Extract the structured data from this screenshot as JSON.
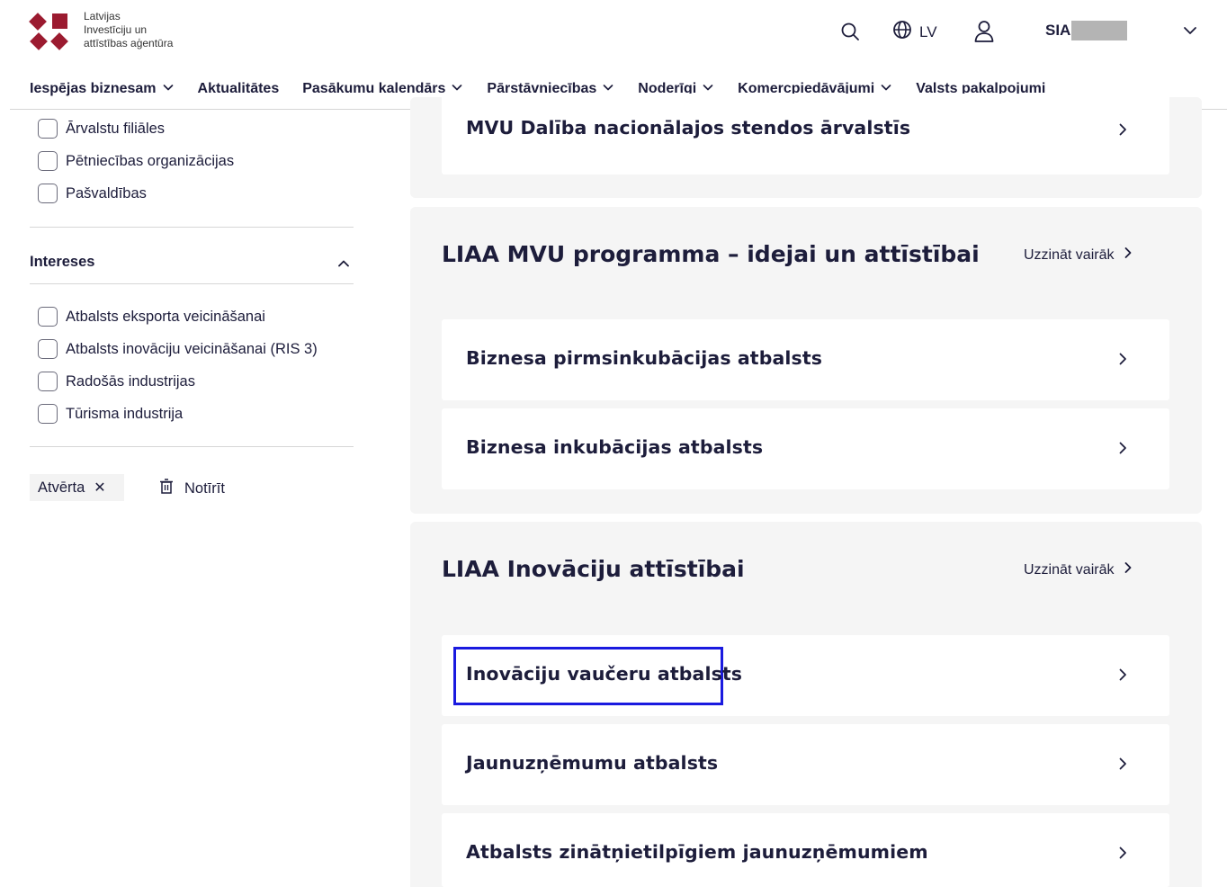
{
  "header": {
    "logo_lines": [
      "Latvijas",
      "Investīciju un",
      "attīstības aģentūra"
    ],
    "lang": "LV",
    "company_prefix": "SIA"
  },
  "nav": {
    "items": [
      {
        "label": "Iespējas biznesam",
        "dropdown": true
      },
      {
        "label": "Aktualitātes",
        "dropdown": false
      },
      {
        "label": "Pasākumu kalendārs",
        "dropdown": true
      },
      {
        "label": "Pārstāvniecības",
        "dropdown": true
      },
      {
        "label": "Noderīgi",
        "dropdown": true
      },
      {
        "label": "Komercpiedāvājumi",
        "dropdown": true
      },
      {
        "label": "Valsts pakalpojumi",
        "dropdown": false
      }
    ]
  },
  "sidebar": {
    "org_options": [
      "Ārvalstu filiāles",
      "Pētniecības organizācijas",
      "Pašvaldības"
    ],
    "interests_title": "Intereses",
    "interest_options": [
      "Atbalsts eksporta veicināšanai",
      "Atbalsts inovāciju veicināšanai (RIS 3)",
      "Radošās industrijas",
      "Tūrisma industrija"
    ],
    "chip_label": "Atvērta",
    "clear_label": "Notīrīt"
  },
  "main": {
    "top_card": "MVU Dalība nacionālajos stendos ārvalstīs",
    "groups": [
      {
        "title": "LIAA MVU programma – idejai un attīstībai",
        "more": "Uzzināt vairāk",
        "cards": [
          "Biznesa pirmsinkubācijas atbalsts",
          "Biznesa inkubācijas atbalsts"
        ]
      },
      {
        "title": "LIAA Inovāciju attīstībai",
        "more": "Uzzināt vairāk",
        "cards": [
          "Inovāciju vaučeru atbalsts",
          "Jaunuzņēmumu atbalsts",
          "Atbalsts zinātņietilpīgiem jaunuzņēmumiem"
        ]
      }
    ]
  },
  "colors": {
    "brand": "#9b1b30",
    "text": "#1d1d3b",
    "highlight": "#1a1adf",
    "panel": "#f5f5f5"
  }
}
